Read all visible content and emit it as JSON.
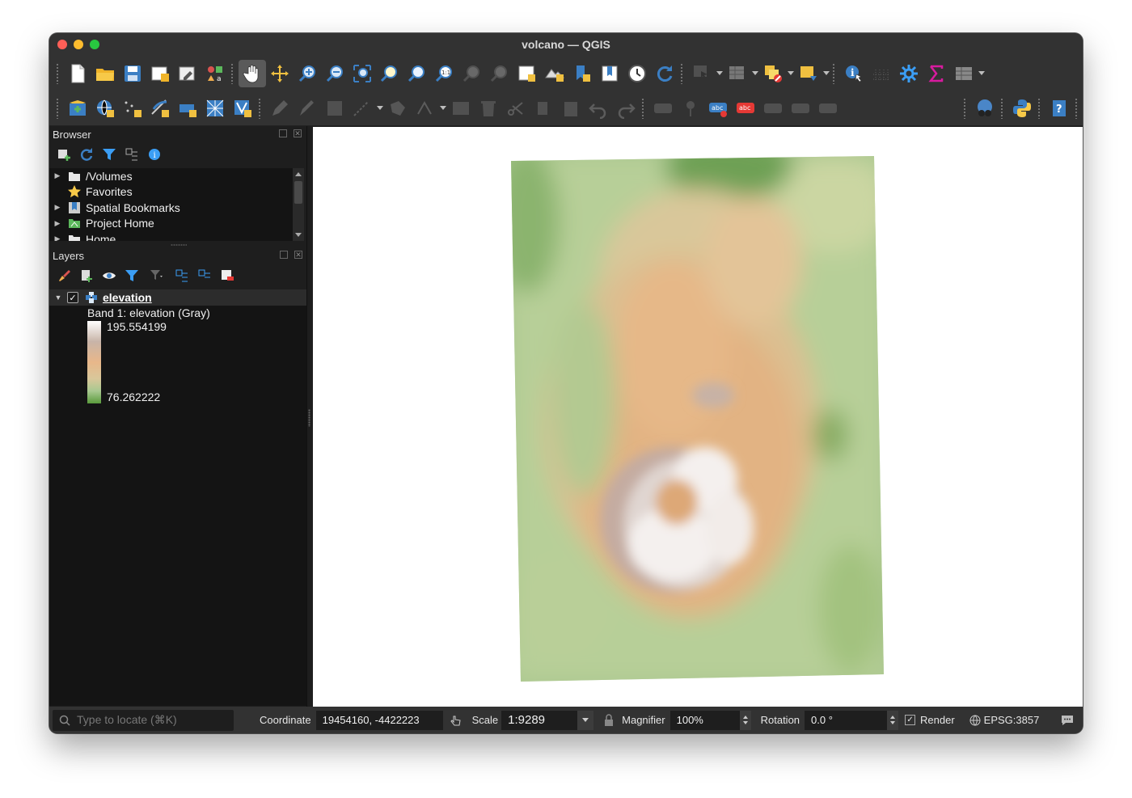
{
  "window": {
    "title": "volcano — QGIS"
  },
  "browser": {
    "title": "Browser",
    "items": [
      {
        "label": "/Volumes",
        "icon": "folder-icon"
      },
      {
        "label": "Favorites",
        "icon": "star-icon"
      },
      {
        "label": "Spatial Bookmarks",
        "icon": "bookmark-icon"
      },
      {
        "label": "Project Home",
        "icon": "project-home-icon"
      },
      {
        "label": "Home",
        "icon": "home-folder-icon"
      }
    ]
  },
  "layers": {
    "title": "Layers",
    "layer": {
      "name": "elevation",
      "checked": true,
      "band_label": "Band 1: elevation (Gray)",
      "max": "195.554199",
      "min": "76.262222"
    }
  },
  "statusbar": {
    "locate_placeholder": "Type to locate (⌘K)",
    "coordinate_label": "Coordinate",
    "coordinate_value": "19454160, -4422223",
    "scale_label": "Scale",
    "scale_value": "1:9289",
    "magnifier_label": "Magnifier",
    "magnifier_value": "100%",
    "rotation_label": "Rotation",
    "rotation_value": "0.0 °",
    "render_label": "Render",
    "render_checked": true,
    "crs": "EPSG:3857"
  },
  "colors": {
    "ramp_low": "#5a9a3c",
    "ramp_mid": "#e8b78a",
    "ramp_high": "#ffffff"
  }
}
